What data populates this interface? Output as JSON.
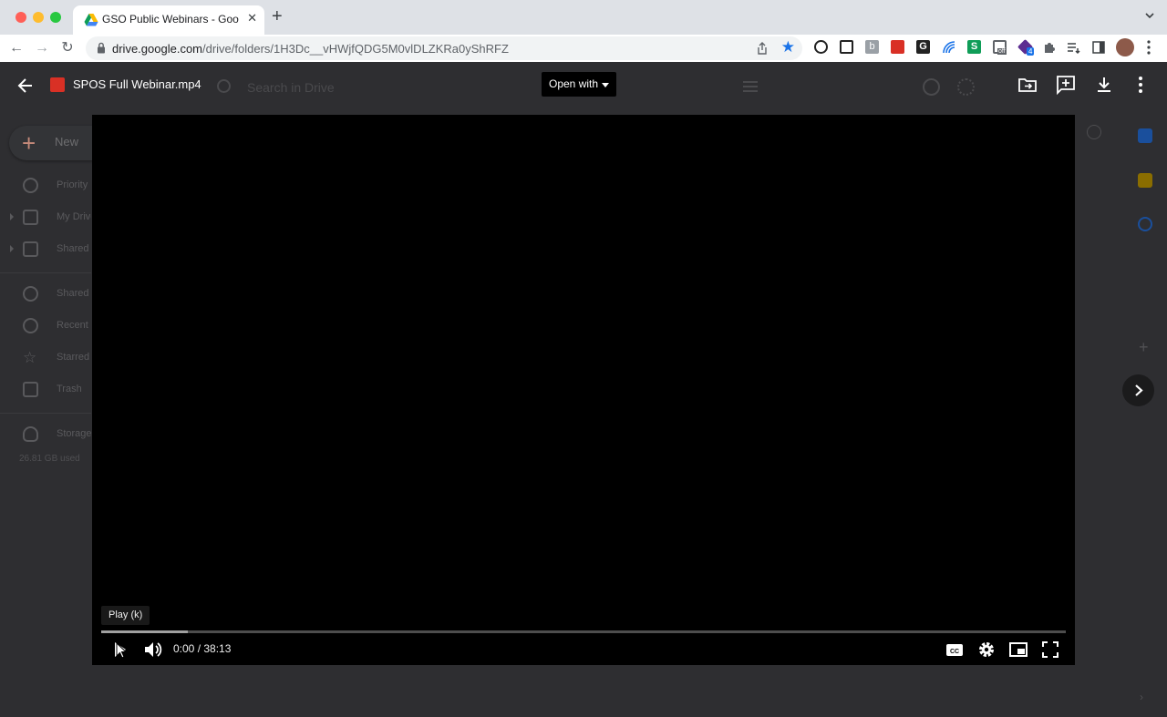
{
  "browser": {
    "tab_title": "GSO Public Webinars - Google",
    "tab_close": "✕",
    "new_tab": "+",
    "url_host": "drive.google.com",
    "url_path": "/drive/folders/1H3Dc__vHWjfQDG5M0vlDLZKRa0yShRFZ",
    "extensions": [
      "ext-icon",
      "ext-icon",
      "b-ext-icon",
      "ext-icon",
      "g-ext-icon",
      "wifi-ext-icon",
      "s-ext-icon",
      "off-ext-icon",
      "badge-ext-icon",
      "puzzle-icon",
      "playlist-icon",
      "sidepanel-icon"
    ],
    "ext_letters": {
      "b": "b",
      "g": "G",
      "s": "S",
      "off": "off",
      "badge": "4"
    }
  },
  "drive": {
    "new_label": "New",
    "nav_items": [
      "Priority",
      "My Drive",
      "Shared drives",
      "Shared with me",
      "Recent",
      "Starred",
      "Trash",
      "Storage"
    ],
    "storage_used": "26.81 GB used",
    "search_placeholder": "Search in Drive"
  },
  "viewer": {
    "file_name": "SPOS Full Webinar.mp4",
    "open_with_label": "Open with"
  },
  "player": {
    "tooltip": "Play (k)",
    "current_time": "0:00",
    "duration": "38:13",
    "time_display": "0:00 / 38:13",
    "progress_fraction": 0.0,
    "buffered_fraction": 0.09
  },
  "colors": {
    "accent_blue": "#1a73e8",
    "file_icon_red": "#d93025"
  }
}
